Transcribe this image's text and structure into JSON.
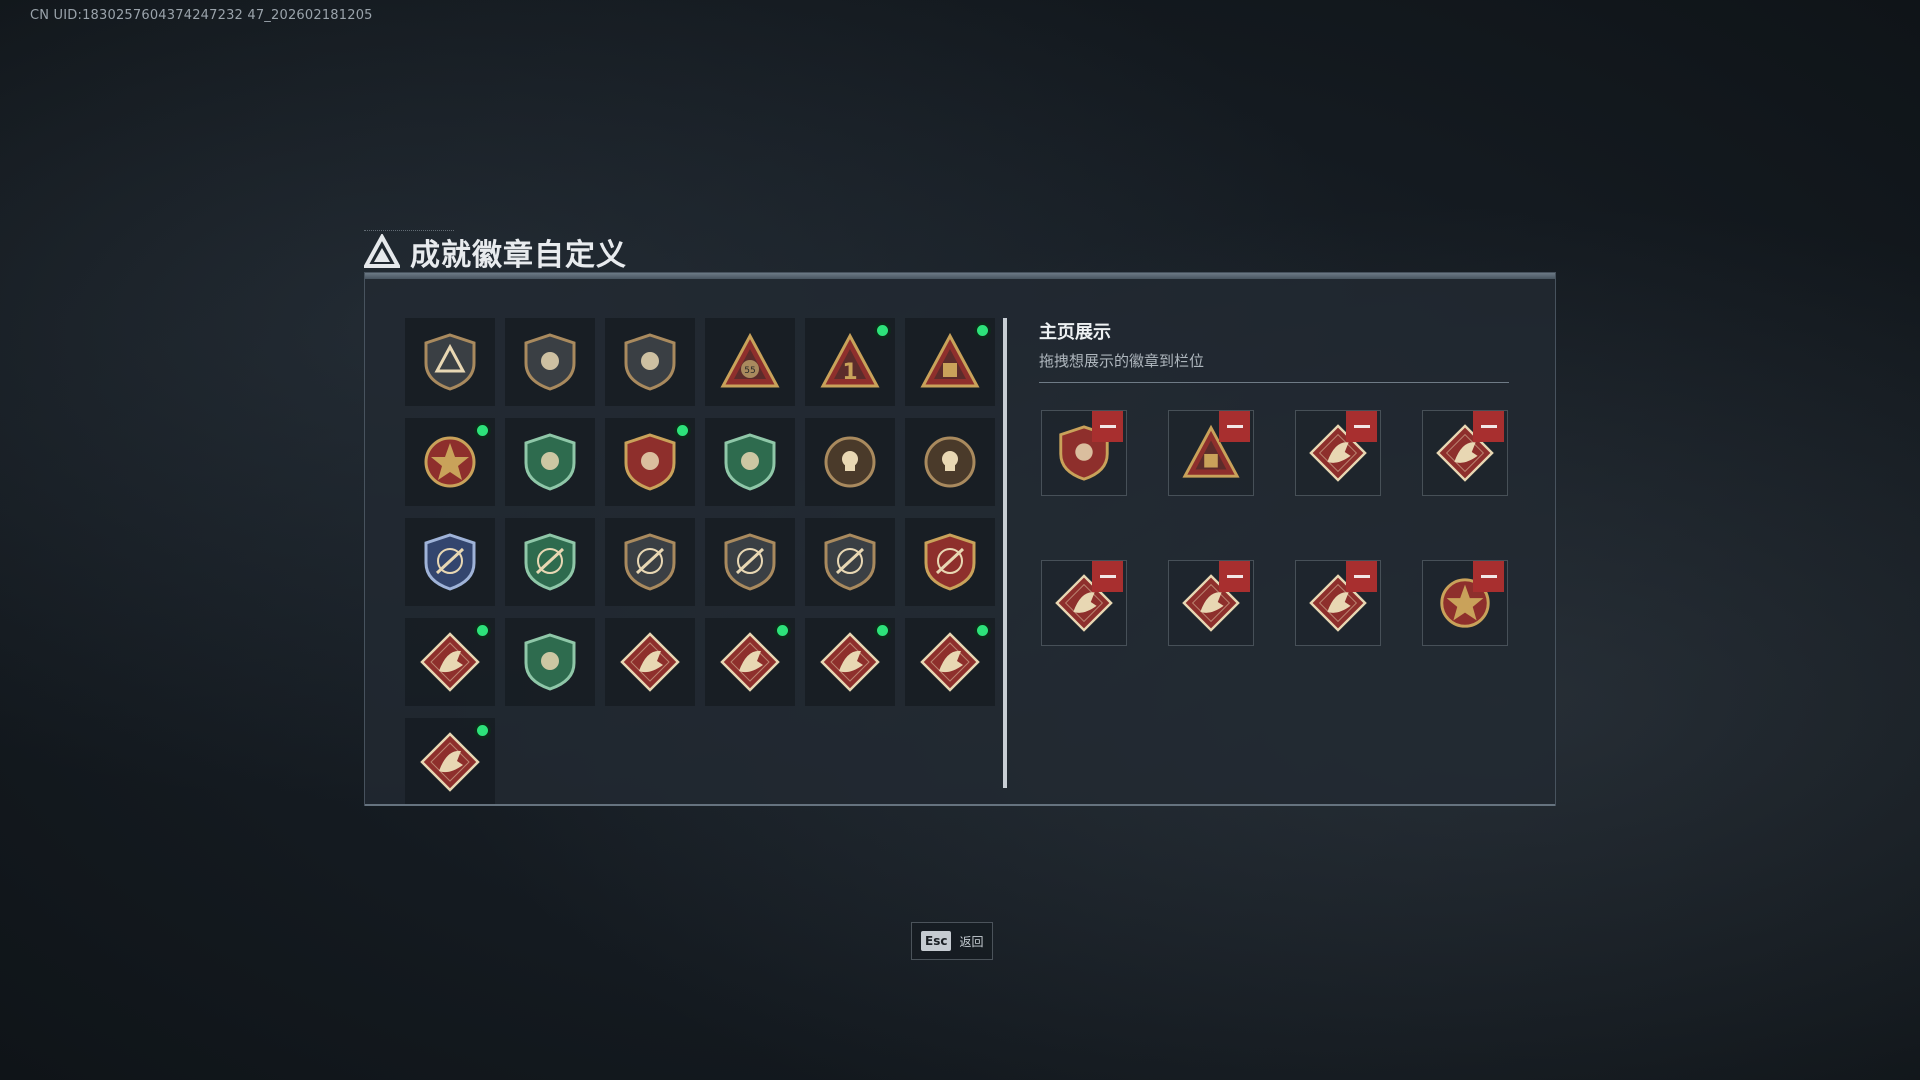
{
  "uid_text": "CN UID:1830257604374247232 47_202602181205",
  "title": "成就徽章自定义",
  "panel": {
    "section_title": "主页展示",
    "section_subtitle": "拖拽想展示的徽章到栏位"
  },
  "badges": [
    {
      "icon": "hex-shield-delta-badge-icon",
      "new": false
    },
    {
      "icon": "helicopter-shield-badge-icon",
      "new": false
    },
    {
      "icon": "winged-blade-shield-badge-icon",
      "new": false
    },
    {
      "icon": "bag-55-triangle-badge-icon",
      "new": false
    },
    {
      "icon": "number-one-triangle-badge-icon",
      "new": true
    },
    {
      "icon": "box-triangle-badge-icon",
      "new": true
    },
    {
      "icon": "star-medal-badge-icon",
      "new": true
    },
    {
      "icon": "green-tool-shield-badge-icon",
      "new": false
    },
    {
      "icon": "gold-eagle-shield-badge-icon",
      "new": true
    },
    {
      "icon": "green-gem-shield-badge-icon",
      "new": false
    },
    {
      "icon": "skull-crosshair-badge-icon",
      "new": false
    },
    {
      "icon": "skull-wreath-badge-icon",
      "new": false
    },
    {
      "icon": "blue-crosshair-crest-badge-icon",
      "new": false
    },
    {
      "icon": "green-crosshair-crest-badge-icon",
      "new": false
    },
    {
      "icon": "bronze-rifle-shield-badge-icon",
      "new": false
    },
    {
      "icon": "bronze-sniper-shield-badge-icon",
      "new": false
    },
    {
      "icon": "bronze-scope-shield-badge-icon",
      "new": false
    },
    {
      "icon": "gold-rifle-crest-badge-icon",
      "new": false
    },
    {
      "icon": "wolf-diamond-badge-icon",
      "new": true
    },
    {
      "icon": "green-medic-hex-badge-icon",
      "new": false
    },
    {
      "icon": "dragon-diamond-badge-icon",
      "new": false
    },
    {
      "icon": "dragon-roar-diamond-badge-icon",
      "new": true
    },
    {
      "icon": "runner-diamond-badge-icon",
      "new": true
    },
    {
      "icon": "horse-diamond-badge-icon",
      "new": true
    },
    {
      "icon": "wrench-diamond-badge-icon",
      "new": true
    }
  ],
  "showcase": [
    {
      "icon": "gold-eagle-shield-badge-icon"
    },
    {
      "icon": "box-triangle-badge-icon"
    },
    {
      "icon": "dragon-roar-diamond-badge-icon"
    },
    {
      "icon": "wolf-diamond-badge-icon"
    },
    {
      "icon": "horse-diamond-badge-icon"
    },
    {
      "icon": "wrench-diamond-badge-icon"
    },
    {
      "icon": "runner-diamond-badge-icon"
    },
    {
      "icon": "star-medal-badge-icon"
    }
  ],
  "footer": {
    "esc_key": "Esc",
    "esc_label": "返回"
  },
  "colors": {
    "new_dot": "#2de37a",
    "remove_button": "#a82f2f",
    "panel_bg": "#222a32"
  }
}
